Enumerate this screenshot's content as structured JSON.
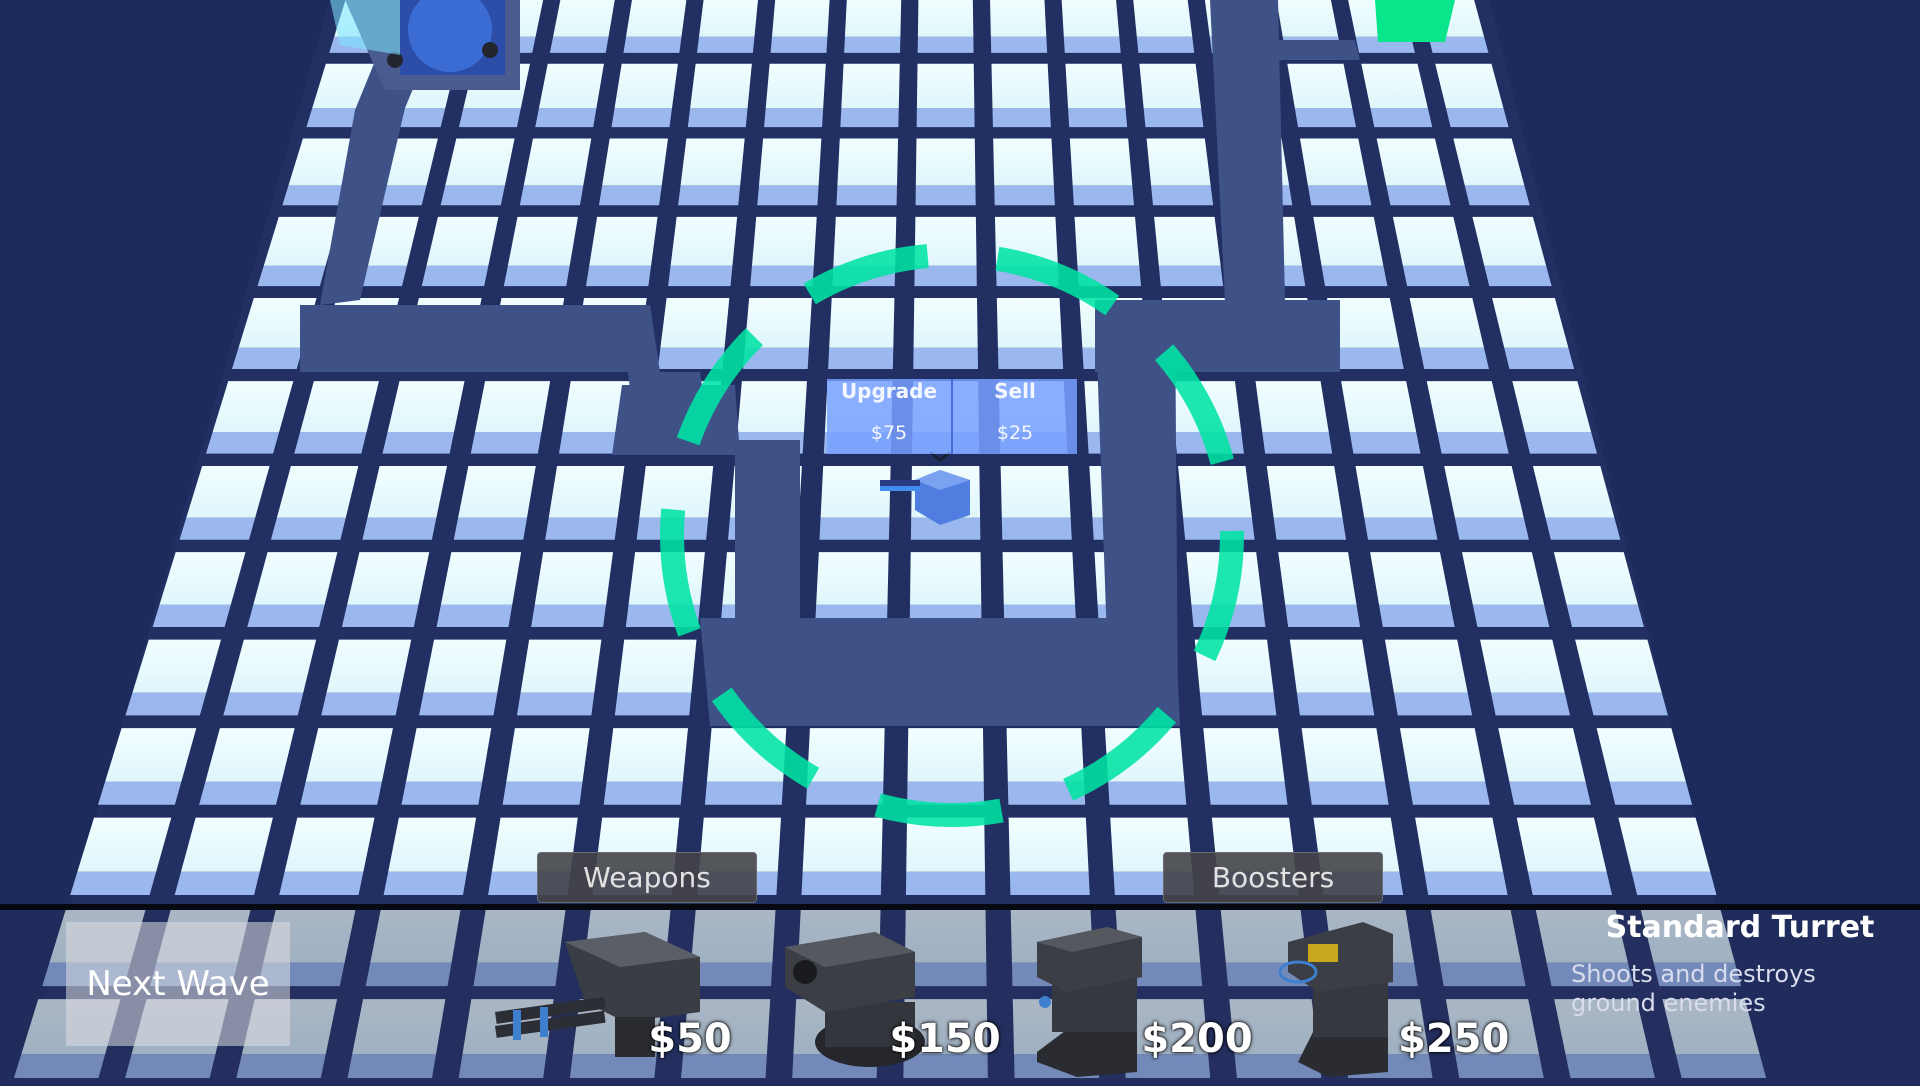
{
  "turret_menu": {
    "upgrade_label": "Upgrade",
    "upgrade_price": "$75",
    "sell_label": "Sell",
    "sell_price": "$25"
  },
  "tabs": {
    "weapons": "Weapons",
    "boosters": "Boosters"
  },
  "next_wave_label": "Next Wave",
  "shop": [
    {
      "price": "$50",
      "icon": "standard-turret-icon"
    },
    {
      "price": "$150",
      "icon": "missile-launcher-icon"
    },
    {
      "price": "$200",
      "icon": "laser-beamer-icon"
    },
    {
      "price": "$250",
      "icon": "booster-icon"
    }
  ],
  "info": {
    "title": "Standard Turret",
    "description": "Shoots and destroys ground enemies"
  },
  "colors": {
    "background": "#1c2a5c",
    "tile": "#e8fbff",
    "path": "#3e5288",
    "range_ring": "#00e4a4"
  }
}
